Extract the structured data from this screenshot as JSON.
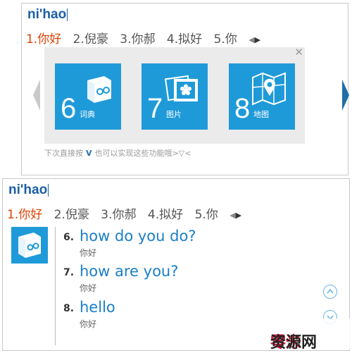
{
  "panel1": {
    "pinyin": "ni'hao",
    "candidates": [
      "1.你好",
      "2.倪豪",
      "3.你郝",
      "4.拟好",
      "5.你"
    ],
    "tiles": [
      {
        "num": "6",
        "label": "词典",
        "icon": "dictionary-book-icon"
      },
      {
        "num": "7",
        "label": "图片",
        "icon": "photo-icon"
      },
      {
        "num": "8",
        "label": "地图",
        "icon": "map-pin-icon"
      }
    ],
    "hint_prefix": "下次直接按",
    "hint_key": "V",
    "hint_suffix": "也可以实现这些功能哦>▽<"
  },
  "panel2": {
    "pinyin": "ni'hao",
    "candidates": [
      "1.你好",
      "2.倪豪",
      "3.你郝",
      "4.拟好",
      "5.你"
    ],
    "entries": [
      {
        "num": "6.",
        "en": "how do you do?",
        "zh": "你好"
      },
      {
        "num": "7.",
        "en": "how are you?",
        "zh": "你好"
      },
      {
        "num": "8.",
        "en": "hello",
        "zh": "你好"
      }
    ]
  },
  "watermark": {
    "part1": "零米",
    "part2": "资源网"
  },
  "colors": {
    "accent": "#1f9ad8",
    "selected": "#e04000",
    "link": "#1a7fc8"
  }
}
